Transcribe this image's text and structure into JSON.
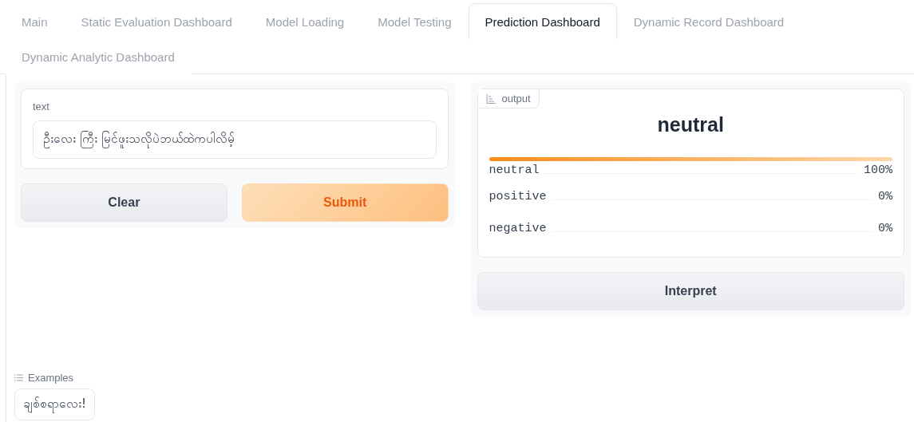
{
  "tabs": [
    {
      "label": "Main",
      "selected": false
    },
    {
      "label": "Static Evaluation Dashboard",
      "selected": false
    },
    {
      "label": "Model Loading",
      "selected": false
    },
    {
      "label": "Model Testing",
      "selected": false
    },
    {
      "label": "Prediction Dashboard",
      "selected": true
    },
    {
      "label": "Dynamic Record Dashboard",
      "selected": false
    },
    {
      "label": "Dynamic Analytic Dashboard",
      "selected": false
    }
  ],
  "input": {
    "label": "text",
    "value": "ဦးလေး ကြီး မြင်ဖူးသလိုပဲဘယ်ထဲကပါလိမ့်"
  },
  "buttons": [
    {
      "label": "Clear",
      "kind": "secondary"
    },
    {
      "label": "Submit",
      "kind": "primary"
    }
  ],
  "output": {
    "label": "output",
    "top_label": "neutral",
    "level": 1,
    "confidences": [
      {
        "label": "neutral",
        "value": "100%"
      },
      {
        "label": "positive",
        "value": "0%"
      },
      {
        "label": "negative",
        "value": "0%"
      }
    ]
  },
  "interpret_button": "Interpret",
  "examples": {
    "label": "Examples",
    "items": [
      "ချစ်စရာလေး!"
    ]
  }
}
